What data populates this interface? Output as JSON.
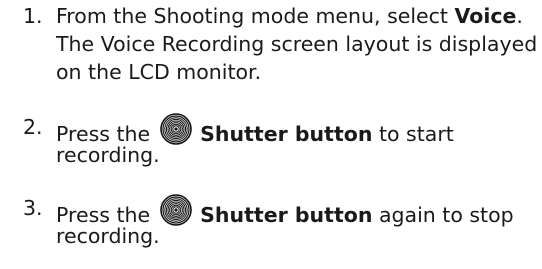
{
  "steps": [
    {
      "number": "1.",
      "line1_prefix": "From the Shooting mode menu, select ",
      "line1_bold": "Voice",
      "line1_suffix": ".",
      "line2": "The Voice Recording screen layout is displayed",
      "line3": "on the LCD monitor."
    },
    {
      "number": "2.",
      "prefix": "Press the",
      "bold": "Shutter button",
      "suffix": " to start",
      "line2": "recording."
    },
    {
      "number": "3.",
      "prefix": "Press the",
      "bold": "Shutter button",
      "suffix": " again to stop",
      "line2": "recording."
    }
  ],
  "icons": {
    "shutter": "shutter-button-icon"
  }
}
